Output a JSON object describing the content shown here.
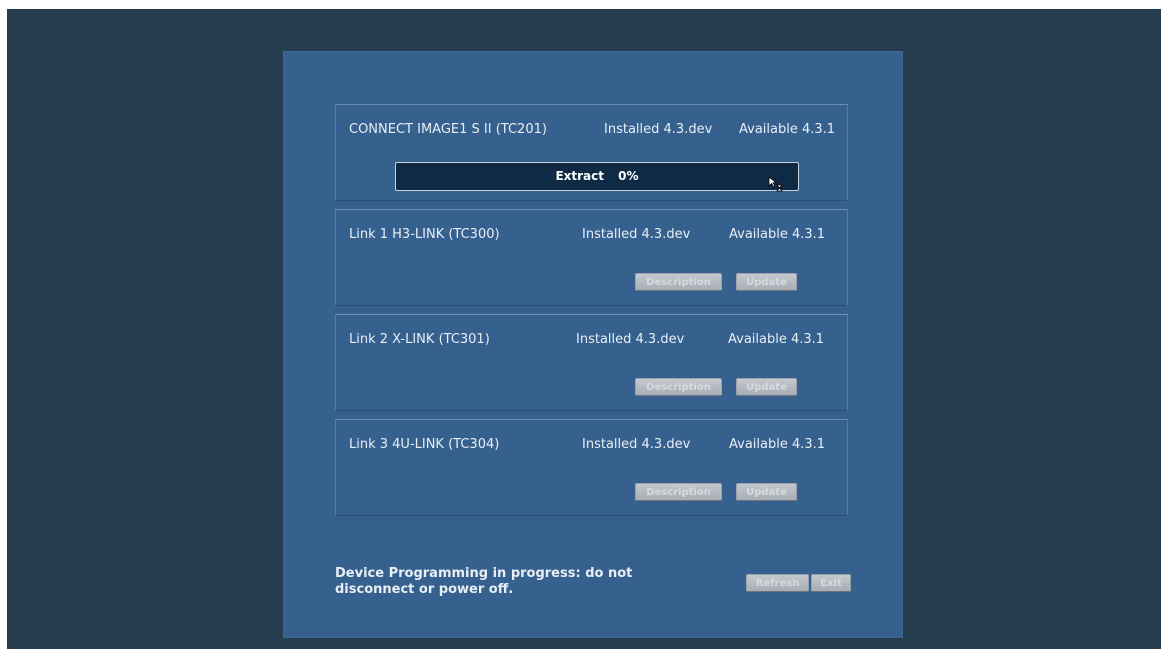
{
  "devices": [
    {
      "name": "CONNECT  IMAGE1 S II (TC201)",
      "installed": "Installed 4.3.dev",
      "available": "Available 4.3.1",
      "progress": {
        "label": "Extract",
        "percent_text": "0%",
        "value": 0
      }
    },
    {
      "name": "Link 1   H3-LINK (TC300)",
      "installed": "Installed 4.3.dev",
      "available": "Available 4.3.1",
      "description_label": "Description",
      "update_label": "Update"
    },
    {
      "name": "Link 2   X-LINK (TC301)",
      "installed": "Installed 4.3.dev",
      "available": "Available 4.3.1",
      "description_label": "Description",
      "update_label": "Update"
    },
    {
      "name": "Link 3   4U-LINK (TC304)",
      "installed": "Installed 4.3.dev",
      "available": "Available 4.3.1",
      "description_label": "Description",
      "update_label": "Update"
    }
  ],
  "footer": {
    "message": "Device Programming in progress: do not disconnect or power off.",
    "refresh_label": "Refresh",
    "exit_label": "Exit"
  },
  "colors": {
    "screen_bg": "#263d4f",
    "dialog_bg": "#36608d",
    "progress_bg": "#0e2a45",
    "disabled_button": "#b0b6bd"
  },
  "icons": {
    "cursor": "busy-pointer-icon"
  }
}
